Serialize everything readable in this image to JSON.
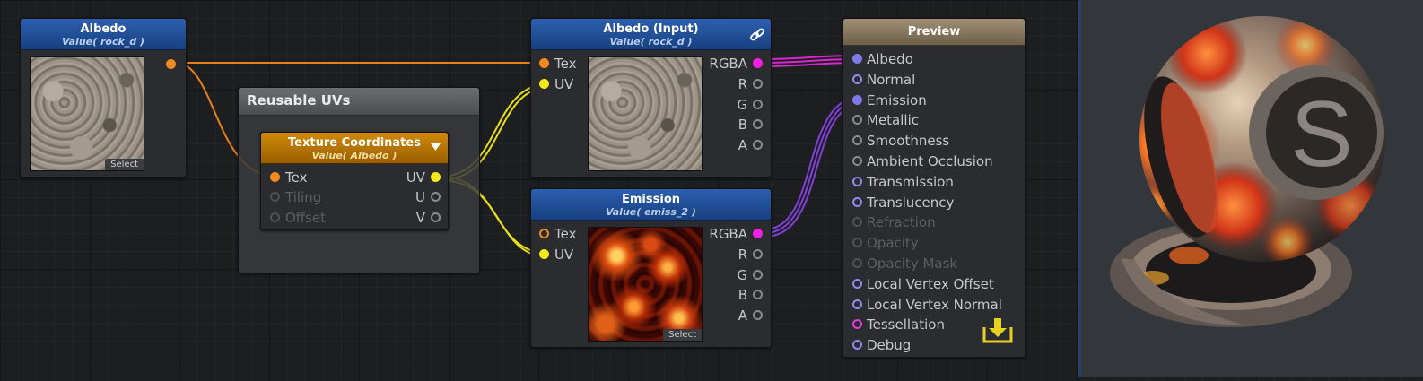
{
  "albedo_node": {
    "title": "Albedo",
    "subtitle": "Value( rock_d )",
    "select_label": "Select"
  },
  "reusable_uvs": {
    "title": "Reusable UVs"
  },
  "texcoord_node": {
    "title": "Texture Coordinates",
    "subtitle": "Value( Albedo )",
    "inputs": [
      "Tex",
      "Tiling",
      "Offset"
    ],
    "outputs": [
      "UV",
      "U",
      "V"
    ]
  },
  "albedo_input_node": {
    "title": "Albedo (Input)",
    "subtitle": "Value( rock_d )",
    "inputs": [
      "Tex",
      "UV"
    ],
    "outputs": [
      "RGBA",
      "R",
      "G",
      "B",
      "A"
    ]
  },
  "emission_node": {
    "title": "Emission",
    "subtitle": "Value( emiss_2 )",
    "inputs": [
      "Tex",
      "UV"
    ],
    "outputs": [
      "RGBA",
      "R",
      "G",
      "B",
      "A"
    ],
    "select_label": "Select"
  },
  "preview_node": {
    "title": "Preview",
    "inputs": [
      "Albedo",
      "Normal",
      "Emission",
      "Metallic",
      "Smoothness",
      "Ambient Occlusion",
      "Transmission",
      "Translucency",
      "Refraction",
      "Opacity",
      "Opacity Mask",
      "Local Vertex Offset",
      "Local Vertex Normal",
      "Tessellation",
      "Debug"
    ]
  },
  "material_preview": {
    "logo_letter": "S"
  },
  "colors": {
    "texture_wire": "#f08a20",
    "uv_wire": "#f4e81a",
    "rgba_wire": "#e028d8",
    "emission_wire": "#8a4ce0",
    "header_blue": "#1f4a90",
    "header_orange": "#c07800",
    "preview_header": "#8c7b62"
  },
  "icons": [
    "link-icon",
    "dropdown-arrow-icon",
    "download-icon"
  ]
}
